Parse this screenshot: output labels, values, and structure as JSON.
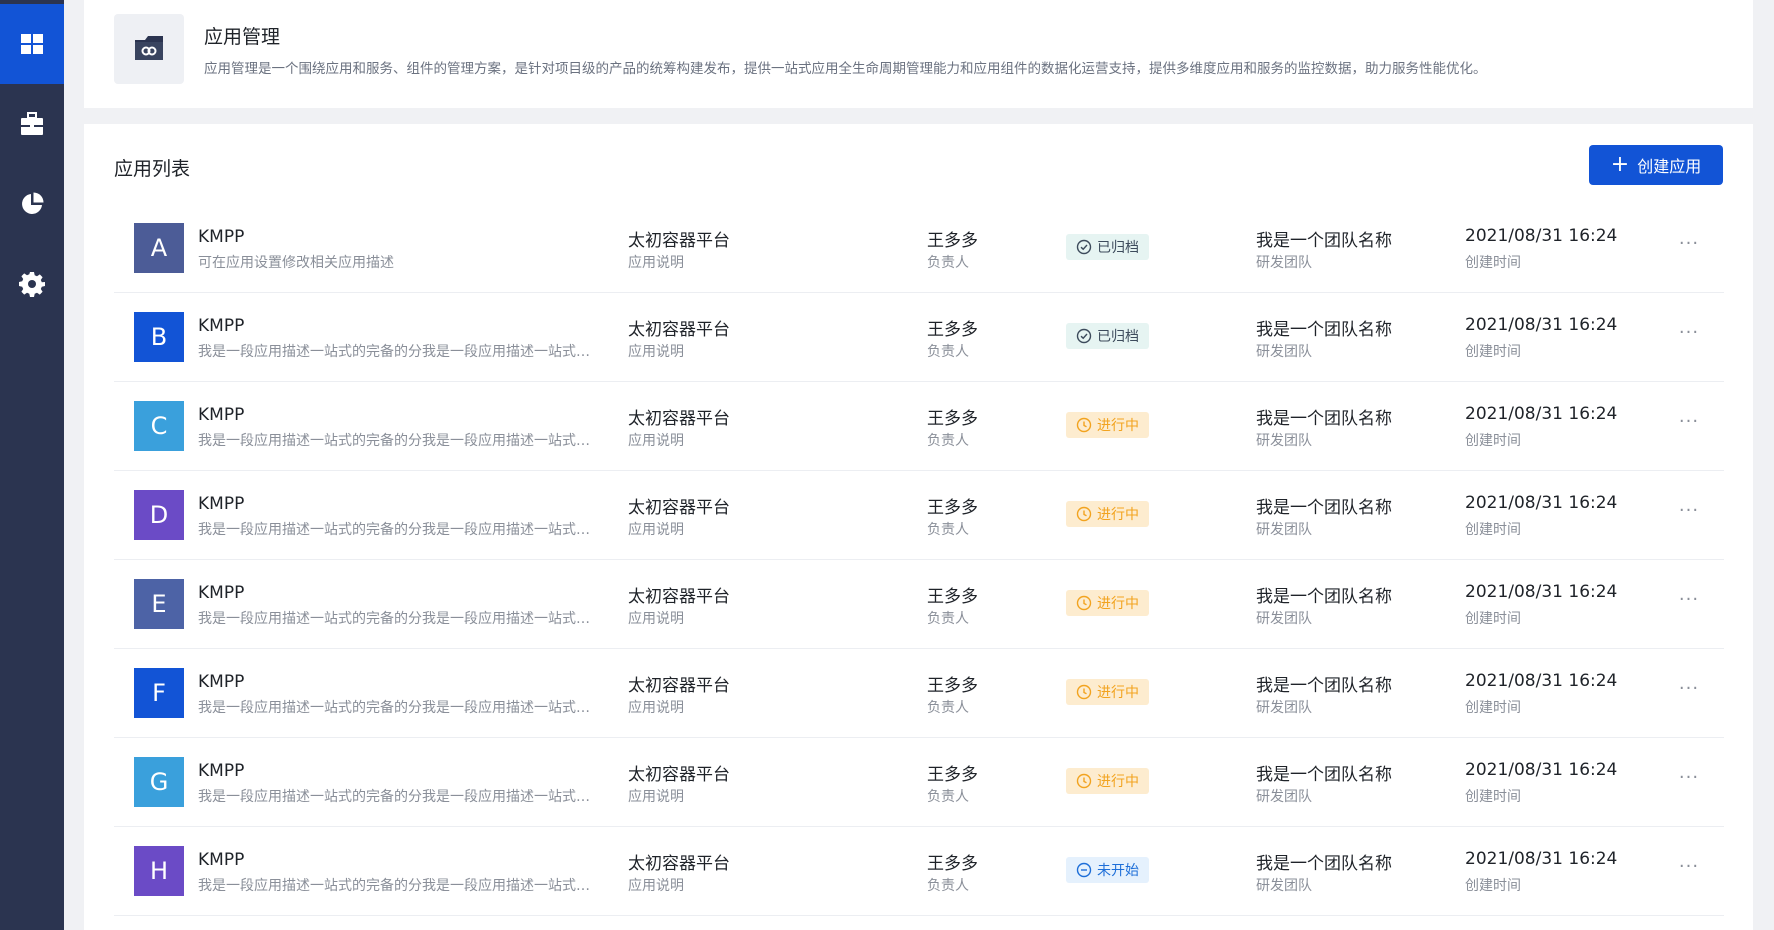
{
  "sidebar": {
    "items": [
      {
        "icon": "dashboard-icon",
        "active": true
      },
      {
        "icon": "toolbox-icon",
        "active": false
      },
      {
        "icon": "pie-chart-icon",
        "active": false
      },
      {
        "icon": "gear-icon",
        "active": false
      }
    ]
  },
  "header": {
    "icon": "app-box-icon",
    "title": "应用管理",
    "description": "应用管理是一个围绕应用和服务、组件的管理方案，是针对项目级的产品的统筹构建发布，提供一站式应用全生命周期管理能力和应用组件的数据化运营支持，提供多维度应用和服务的监控数据，助力服务性能优化。"
  },
  "list": {
    "title": "应用列表",
    "create_button": {
      "plus": "+",
      "label": "创建应用"
    },
    "colors": {
      "A": "#4c5c97",
      "B": "#1254d6",
      "C": "#3aa0dc",
      "D": "#6b4bc6",
      "E": "#4d63a6",
      "F": "#1254d6",
      "G": "#3aa0dc",
      "H": "#6b4bc6"
    },
    "rows": [
      {
        "letter": "A",
        "name": "KMPP",
        "desc": "可在应用设置修改相关应用描述",
        "platform": "太初容器平台",
        "platform_sub": "应用说明",
        "owner": "王多多",
        "owner_sub": "负责人",
        "status": "已归档",
        "status_type": "archived",
        "team": "我是一个团队名称",
        "team_sub": "研发团队",
        "time": "2021/08/31 16:24",
        "time_sub": "创建时间",
        "more": "···"
      },
      {
        "letter": "B",
        "name": "KMPP",
        "desc": "我是一段应用描述一站式的完备的分我是一段应用描述一站式的完备的分",
        "platform": "太初容器平台",
        "platform_sub": "应用说明",
        "owner": "王多多",
        "owner_sub": "负责人",
        "status": "已归档",
        "status_type": "archived",
        "team": "我是一个团队名称",
        "team_sub": "研发团队",
        "time": "2021/08/31 16:24",
        "time_sub": "创建时间",
        "more": "···"
      },
      {
        "letter": "C",
        "name": "KMPP",
        "desc": "我是一段应用描述一站式的完备的分我是一段应用描述一站式的完备的分",
        "platform": "太初容器平台",
        "platform_sub": "应用说明",
        "owner": "王多多",
        "owner_sub": "负责人",
        "status": "进行中",
        "status_type": "progress",
        "team": "我是一个团队名称",
        "team_sub": "研发团队",
        "time": "2021/08/31 16:24",
        "time_sub": "创建时间",
        "more": "···"
      },
      {
        "letter": "D",
        "name": "KMPP",
        "desc": "我是一段应用描述一站式的完备的分我是一段应用描述一站式的完备的分",
        "platform": "太初容器平台",
        "platform_sub": "应用说明",
        "owner": "王多多",
        "owner_sub": "负责人",
        "status": "进行中",
        "status_type": "progress",
        "team": "我是一个团队名称",
        "team_sub": "研发团队",
        "time": "2021/08/31 16:24",
        "time_sub": "创建时间",
        "more": "···"
      },
      {
        "letter": "E",
        "name": "KMPP",
        "desc": "我是一段应用描述一站式的完备的分我是一段应用描述一站式的完备的分",
        "platform": "太初容器平台",
        "platform_sub": "应用说明",
        "owner": "王多多",
        "owner_sub": "负责人",
        "status": "进行中",
        "status_type": "progress",
        "team": "我是一个团队名称",
        "team_sub": "研发团队",
        "time": "2021/08/31 16:24",
        "time_sub": "创建时间",
        "more": "···"
      },
      {
        "letter": "F",
        "name": "KMPP",
        "desc": "我是一段应用描述一站式的完备的分我是一段应用描述一站式的完备的分",
        "platform": "太初容器平台",
        "platform_sub": "应用说明",
        "owner": "王多多",
        "owner_sub": "负责人",
        "status": "进行中",
        "status_type": "progress",
        "team": "我是一个团队名称",
        "team_sub": "研发团队",
        "time": "2021/08/31 16:24",
        "time_sub": "创建时间",
        "more": "···"
      },
      {
        "letter": "G",
        "name": "KMPP",
        "desc": "我是一段应用描述一站式的完备的分我是一段应用描述一站式的完备的分",
        "platform": "太初容器平台",
        "platform_sub": "应用说明",
        "owner": "王多多",
        "owner_sub": "负责人",
        "status": "进行中",
        "status_type": "progress",
        "team": "我是一个团队名称",
        "team_sub": "研发团队",
        "time": "2021/08/31 16:24",
        "time_sub": "创建时间",
        "more": "···"
      },
      {
        "letter": "H",
        "name": "KMPP",
        "desc": "我是一段应用描述一站式的完备的分我是一段应用描述一站式的完备的分",
        "platform": "太初容器平台",
        "platform_sub": "应用说明",
        "owner": "王多多",
        "owner_sub": "负责人",
        "status": "未开始",
        "status_type": "notstart",
        "team": "我是一个团队名称",
        "team_sub": "研发团队",
        "time": "2021/08/31 16:24",
        "time_sub": "创建时间",
        "more": "···"
      }
    ]
  }
}
